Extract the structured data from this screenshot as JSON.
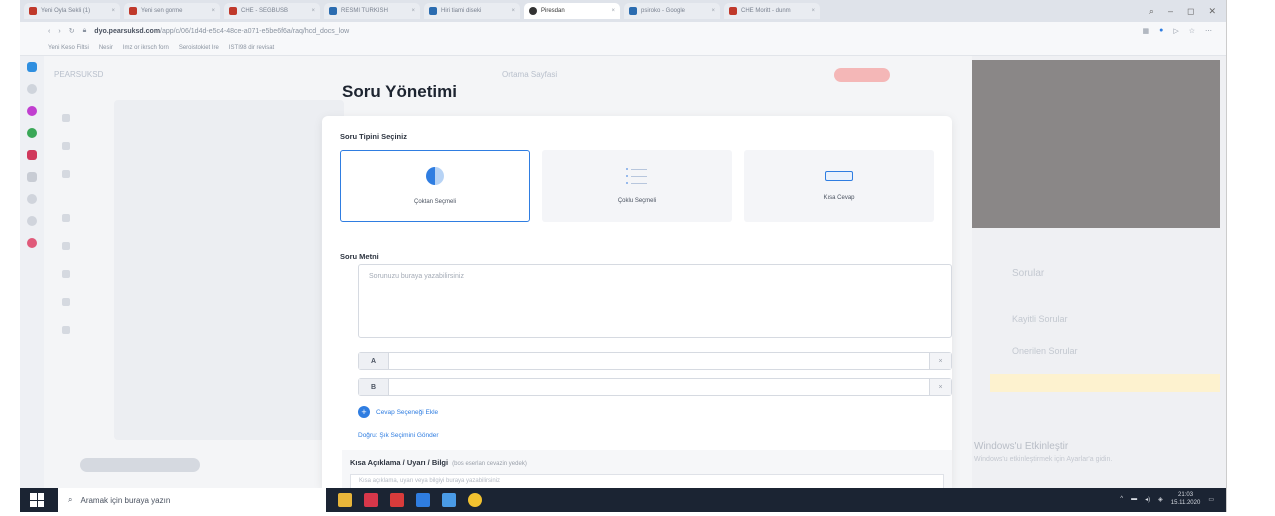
{
  "browser": {
    "tabs": [
      {
        "label": "Yeni Oyla Sekli (1)",
        "color": "#c0392b"
      },
      {
        "label": "Yeni sen gorme",
        "color": "#c0392b"
      },
      {
        "label": "CHE - SEGBUSB",
        "color": "#c0392b"
      },
      {
        "label": "RESMI TURKISH",
        "color": "#2b6cb0"
      },
      {
        "label": "Hiri tiami diseki",
        "color": "#2b6cb0"
      },
      {
        "label": "Piresdan",
        "color": "#333333",
        "active": true
      },
      {
        "label": "psiroko - Google",
        "color": "#2b6cb0"
      },
      {
        "label": "CHE Moritt - dunm",
        "color": "#c0392b"
      }
    ],
    "url_domain": "dyo.pearsuksd.com",
    "url_path": "/app/c/06/1d4d-e5c4-48ce-a071-e5be6f6a/raq/hcd_docs_low",
    "bookmarks": [
      "Yeni Keso Filtsi",
      "Nesir",
      "Imz or ikrsch forn",
      "Seroistokiet Ire",
      "ISTI98 dir revisat"
    ]
  },
  "app": {
    "header_brand": "PEARSUKSD",
    "page_tab": "Ortama Sayfasi",
    "right_panel": {
      "section_title": "Sorular",
      "saved_questions": "Kayitli Sorular",
      "suggested_questions": "Onerilen Sorular"
    },
    "activation_title": "Windows'u Etkinleştir",
    "activation_subtitle": "Windows'u etkinleştirmek için Ayarlar'a gidin."
  },
  "modal": {
    "title": "Soru Yönetimi",
    "type_section_label": "Soru Tipini Seçiniz",
    "question_types": [
      {
        "label": "Çoktan Seçmeli",
        "icon": "radio-half-icon",
        "selected": true
      },
      {
        "label": "Çoklu Seçmeli",
        "icon": "checklist-icon",
        "selected": false
      },
      {
        "label": "Kısa Cevap",
        "icon": "text-field-icon",
        "selected": false
      }
    ],
    "question_text_label": "Soru Metni",
    "question_placeholder": "Sorunuzu buraya yazabilirsiniz",
    "options": [
      {
        "letter": "A",
        "value": ""
      },
      {
        "letter": "B",
        "value": ""
      }
    ],
    "delete_symbol": "×",
    "add_option_label": "Cevap Seçeneği Ekle",
    "switch_type_link": "Doğru: Şık Seçimini Gönder",
    "note_label": "Kısa Açıklama / Uyarı / Bilgi",
    "note_hint": "(bos eserlan cevazin yedek)",
    "note_placeholder": "Kısa açıklama, uyarı veya bilgiyi buraya yazabilirsiniz"
  },
  "taskbar": {
    "search_placeholder": "Aramak için buraya yazın",
    "time": "21:03",
    "date": "15.11.2020"
  },
  "colors": {
    "accent": "#2f7de1",
    "taskbar": "#1b2433"
  }
}
